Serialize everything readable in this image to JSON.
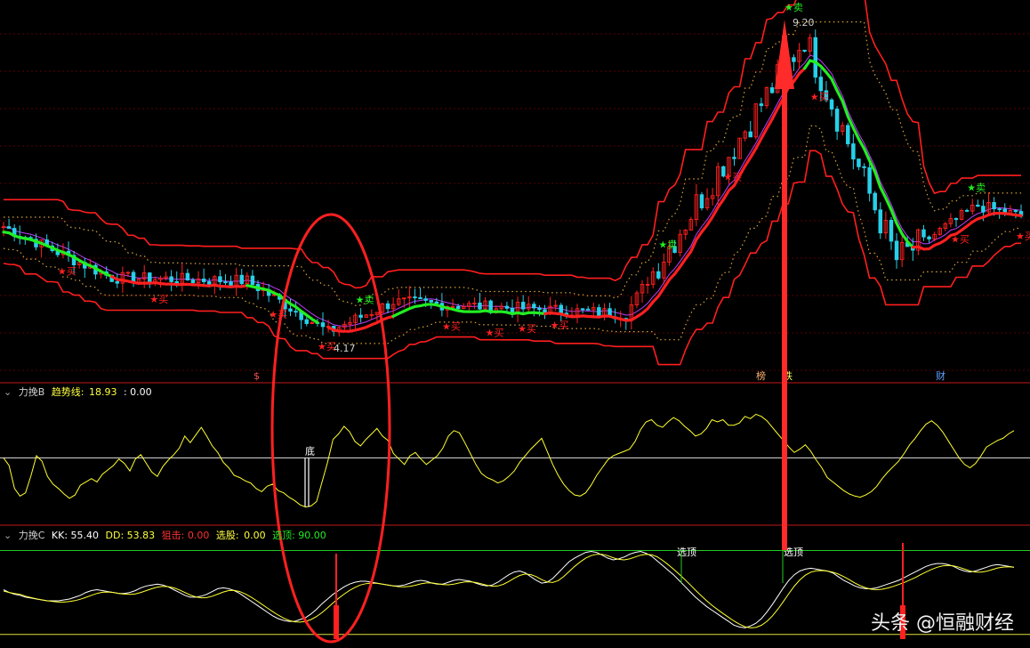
{
  "panel1": {
    "price_labels": {
      "high": "9.20",
      "low": "4.17"
    },
    "signal_labels": {
      "buy": "买",
      "sell": "卖"
    },
    "bottom_markers": [
      "$",
      "榜",
      "跌",
      "财"
    ],
    "colors": {
      "band": "#ff1e1e",
      "dots": "#d8a23a",
      "up": "#ff2020",
      "down": "#27d0e8",
      "green": "#22ee22"
    }
  },
  "panel2": {
    "name": "力挽B",
    "indicator_label": "趋势线:",
    "indicator_value": "18.93",
    "extra_value": ": 0.00",
    "marker": "底"
  },
  "panel3": {
    "name": "力挽C",
    "kk": "KK: 55.40",
    "dd": "DD: 53.83",
    "snipe": "狙击: 0.00",
    "select_label": "选股:",
    "select_value": "0.00",
    "top_pick": "选顶: 90.00",
    "marker": "选顶"
  },
  "watermark": "头条 @恒融财经",
  "chart_data": [
    {
      "type": "candlestick",
      "title": "",
      "y_range": [
        3.5,
        9.6
      ],
      "annotations": [
        {
          "label": "9.20",
          "kind": "high"
        },
        {
          "label": "4.17",
          "kind": "low"
        }
      ],
      "segments": [
        {
          "from": 0,
          "to": 20,
          "start": 5.95,
          "end": 5.1
        },
        {
          "from": 20,
          "to": 45,
          "start": 5.1,
          "end": 5.05
        },
        {
          "from": 45,
          "to": 60,
          "start": 5.05,
          "end": 4.2
        },
        {
          "from": 60,
          "to": 72,
          "start": 4.2,
          "end": 4.7
        },
        {
          "from": 72,
          "to": 115,
          "start": 4.7,
          "end": 4.5
        },
        {
          "from": 115,
          "to": 130,
          "start": 4.5,
          "end": 6.6
        },
        {
          "from": 130,
          "to": 148,
          "start": 6.6,
          "end": 9.1
        },
        {
          "from": 148,
          "to": 165,
          "start": 9.1,
          "end": 5.4
        },
        {
          "from": 165,
          "to": 180,
          "start": 5.4,
          "end": 6.3
        },
        {
          "from": 180,
          "to": 189,
          "start": 6.3,
          "end": 6.1
        }
      ]
    },
    {
      "type": "line",
      "name": "趋势线",
      "y_range": [
        -10,
        105
      ],
      "ref_line": 50,
      "values": [
        50,
        43,
        22,
        15,
        18,
        34,
        52,
        47,
        33,
        26,
        22,
        17,
        13,
        16,
        25,
        28,
        31,
        28,
        35,
        39,
        43,
        49,
        45,
        38,
        49,
        53,
        45,
        37,
        33,
        42,
        48,
        53,
        59,
        70,
        64,
        71,
        78,
        70,
        61,
        55,
        46,
        41,
        34,
        32,
        29,
        27,
        22,
        19,
        24,
        26,
        20,
        18,
        14,
        11,
        7,
        5,
        6,
        10,
        28,
        46,
        67,
        72,
        79,
        74,
        65,
        61,
        67,
        72,
        77,
        70,
        66,
        54,
        49,
        44,
        52,
        55,
        49,
        44,
        48,
        52,
        59,
        70,
        75,
        73,
        64,
        54,
        44,
        36,
        32,
        30,
        27,
        29,
        33,
        38,
        46,
        52,
        58,
        63,
        68,
        56,
        44,
        34,
        26,
        20,
        16,
        15,
        18,
        25,
        34,
        41,
        48,
        52,
        54,
        56,
        58,
        65,
        76,
        83,
        85,
        80,
        78,
        83,
        87,
        84,
        79,
        75,
        70,
        72,
        77,
        85,
        83,
        85,
        80,
        80,
        82,
        88,
        86,
        90,
        88,
        84,
        78,
        72,
        66,
        60,
        55,
        58,
        62,
        56,
        48,
        41,
        32,
        28,
        24,
        20,
        17,
        15,
        14,
        16,
        19,
        24,
        31,
        37,
        42,
        47,
        54,
        62,
        68,
        75,
        81,
        84,
        80,
        74,
        66,
        58,
        50,
        44,
        41,
        45,
        52,
        60,
        63,
        66,
        68,
        72,
        75
      ]
    },
    {
      "type": "line",
      "name": "KK",
      "y_range": [
        -5,
        100
      ],
      "ref_lines": [
        0,
        90
      ],
      "values": [
        48,
        45,
        43,
        42,
        40,
        39,
        38,
        37,
        36,
        36,
        36,
        37,
        38,
        40,
        42,
        45,
        47,
        48,
        47,
        46,
        45,
        44,
        44,
        45,
        47,
        50,
        52,
        53,
        54,
        53,
        51,
        48,
        45,
        42,
        40,
        40,
        41,
        43,
        46,
        49,
        50,
        49,
        47,
        44,
        40,
        36,
        32,
        28,
        24,
        20,
        17,
        15,
        14,
        14,
        16,
        18,
        22,
        27,
        33,
        38,
        43,
        47,
        51,
        54,
        56,
        57,
        57,
        56,
        55,
        54,
        53,
        52,
        52,
        53,
        55,
        57,
        58,
        57,
        55,
        54,
        54,
        56,
        58,
        59,
        58,
        57,
        55,
        53,
        52,
        53,
        56,
        60,
        64,
        67,
        68,
        66,
        62,
        58,
        55,
        56,
        60,
        66,
        72,
        78,
        82,
        85,
        88,
        89,
        88,
        85,
        82,
        80,
        81,
        83,
        86,
        88,
        89,
        87,
        84,
        79,
        74,
        69,
        64,
        58,
        52,
        46,
        40,
        35,
        30,
        26,
        22,
        18,
        14,
        10,
        8,
        7,
        9,
        12,
        17,
        24,
        32,
        41,
        50,
        58,
        64,
        68,
        70,
        71,
        70,
        69,
        68,
        66,
        62,
        58,
        55,
        52,
        50,
        49,
        49,
        50,
        52,
        54,
        56,
        58,
        61,
        64,
        67,
        70,
        73,
        75,
        76,
        76,
        75,
        73,
        70,
        68,
        67,
        68,
        70,
        72,
        74,
        75,
        74,
        73,
        72
      ]
    }
  ]
}
